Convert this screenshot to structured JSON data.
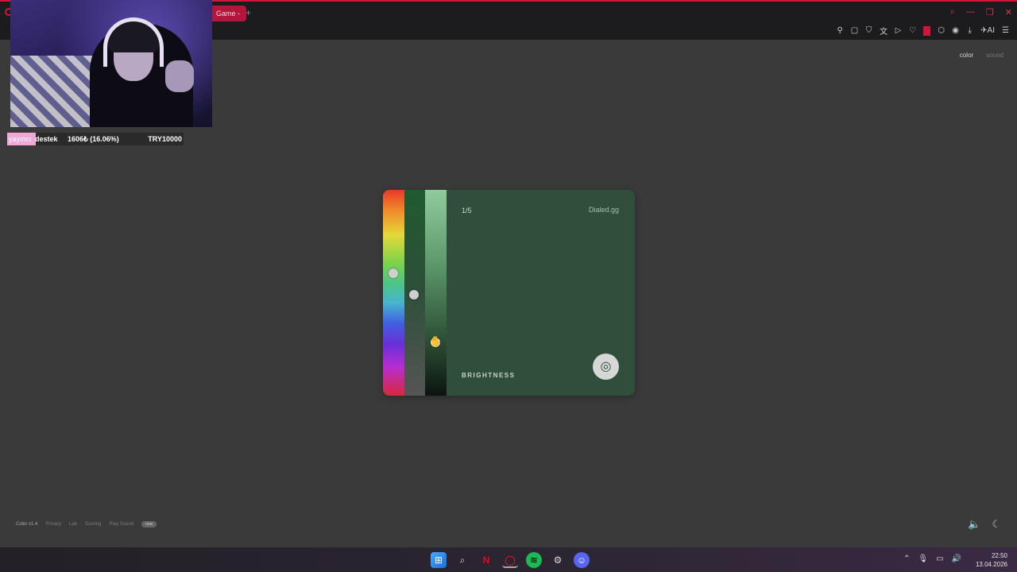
{
  "browser": {
    "tab_title": "Game -",
    "new_tab_label": "+",
    "window_controls": [
      "⌕",
      "—",
      "❐",
      "✕"
    ],
    "toolbar_icons": [
      "pin-icon",
      "snapshot-icon",
      "shield-icon",
      "translate-icon",
      "play-icon",
      "heart-icon",
      "extensions-icon",
      "profile-icon",
      "download-icon",
      "aria-icon",
      "menu-icon"
    ],
    "ai_label": "AI"
  },
  "stream_overlay": {
    "label_pink": "yayıncı",
    "label_destek": "destek",
    "progress": "1606₺ (16.06%)",
    "goal": "TRY10000"
  },
  "page": {
    "mode_color": "color",
    "mode_sound": "sound"
  },
  "game": {
    "counter": "1/5",
    "brand": "Dialed.gg",
    "stage_label": "BRIGHTNESS",
    "current_color": "#2f4f3a",
    "hue_level": 0.4,
    "saturation_level": 0.51,
    "brightness_level": 0.74
  },
  "footer": {
    "version": "Color v1.4",
    "links": [
      "Privacy",
      "Lab",
      "Scoring",
      "Play Sound"
    ],
    "pill": "new"
  },
  "taskbar": {
    "apps": [
      "windows-start-icon",
      "search-icon",
      "netflix-icon",
      "opera-gx-icon",
      "spotify-icon",
      "steam-icon",
      "discord-icon"
    ],
    "time": "22:50",
    "date": "13.04.2026"
  }
}
